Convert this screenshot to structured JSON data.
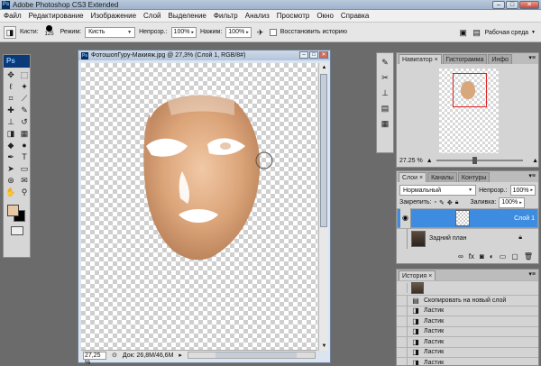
{
  "app": {
    "title": "Adobe Photoshop CS3 Extended",
    "app_icon": "Ps",
    "window_buttons": [
      "–",
      "□",
      "✕"
    ]
  },
  "menu": [
    "Файл",
    "Редактирование",
    "Изображение",
    "Слой",
    "Выделение",
    "Фильтр",
    "Анализ",
    "Просмотр",
    "Окно",
    "Справка"
  ],
  "options": {
    "brushes_label": "Кисти:",
    "brush_size": "125",
    "mode_label": "Режим:",
    "mode_value": "Кисть",
    "opacity_label": "Непрозр.:",
    "opacity_value": "100%",
    "pressure_label": "Нажим:",
    "pressure_value": "100%",
    "restore_history_label": "Восстановить историю",
    "workspace_label": "Рабочая среда"
  },
  "toolbox": {
    "badge": "Ps",
    "tools": [
      {
        "name": "move-tool-icon",
        "glyph": "✥"
      },
      {
        "name": "marquee-tool-icon",
        "glyph": "⬚"
      },
      {
        "name": "lasso-tool-icon",
        "glyph": "ℓ"
      },
      {
        "name": "magic-wand-tool-icon",
        "glyph": "✦"
      },
      {
        "name": "crop-tool-icon",
        "glyph": "⌗"
      },
      {
        "name": "slice-tool-icon",
        "glyph": "⟋"
      },
      {
        "name": "healing-tool-icon",
        "glyph": "✚"
      },
      {
        "name": "brush-tool-icon",
        "glyph": "✎"
      },
      {
        "name": "stamp-tool-icon",
        "glyph": "⊥"
      },
      {
        "name": "history-brush-tool-icon",
        "glyph": "↺"
      },
      {
        "name": "eraser-tool-icon",
        "glyph": "◨"
      },
      {
        "name": "gradient-tool-icon",
        "glyph": "▦"
      },
      {
        "name": "blur-tool-icon",
        "glyph": "◆"
      },
      {
        "name": "dodge-tool-icon",
        "glyph": "●"
      },
      {
        "name": "pen-tool-icon",
        "glyph": "✒"
      },
      {
        "name": "type-tool-icon",
        "glyph": "T"
      },
      {
        "name": "path-select-tool-icon",
        "glyph": "➤"
      },
      {
        "name": "shape-tool-icon",
        "glyph": "▭"
      },
      {
        "name": "3d-tool-icon",
        "glyph": "⊛"
      },
      {
        "name": "note-tool-icon",
        "glyph": "✉"
      },
      {
        "name": "hand-tool-icon",
        "glyph": "✋"
      },
      {
        "name": "zoom-tool-icon",
        "glyph": "⚲"
      }
    ],
    "foreground_color": "#e8c7a6",
    "background_color": "#000000"
  },
  "document": {
    "title": "ФотошопГуру-Макияж.jpg @ 27,3% (Слой 1, RGB/8#)",
    "zoom": "27,25 %",
    "doc_info": "Док: 26,8M/46,6M"
  },
  "side_strip_icons": [
    "brush-preset-icon",
    "tools-icon",
    "clone-source-icon",
    "info-icon",
    "table-icon"
  ],
  "navigator": {
    "tabs": [
      "Навигатор ×",
      "Гистограмма",
      "Инфо"
    ],
    "zoom": "27.25 %"
  },
  "layers": {
    "tabs": [
      "Слои ×",
      "Каналы",
      "Контуры"
    ],
    "blend_mode": "Нормальный",
    "opacity_label": "Непрозр.:",
    "opacity_value": "100%",
    "lock_label": "Закрепить:",
    "fill_label": "Заливка:",
    "fill_value": "100%",
    "items": [
      {
        "name": "Слой 1",
        "selected": true
      },
      {
        "name": "Задний план",
        "selected": false
      }
    ]
  },
  "history": {
    "tabs": [
      "История ×"
    ],
    "items": [
      "Скопировать на новый слой",
      "Ластик",
      "Ластик",
      "Ластик",
      "Ластик",
      "Ластик",
      "Ластик",
      "Ластик"
    ],
    "current_index": 7
  },
  "colors": {
    "accent": "#3d8ce0",
    "skin": "#d8a77b"
  }
}
